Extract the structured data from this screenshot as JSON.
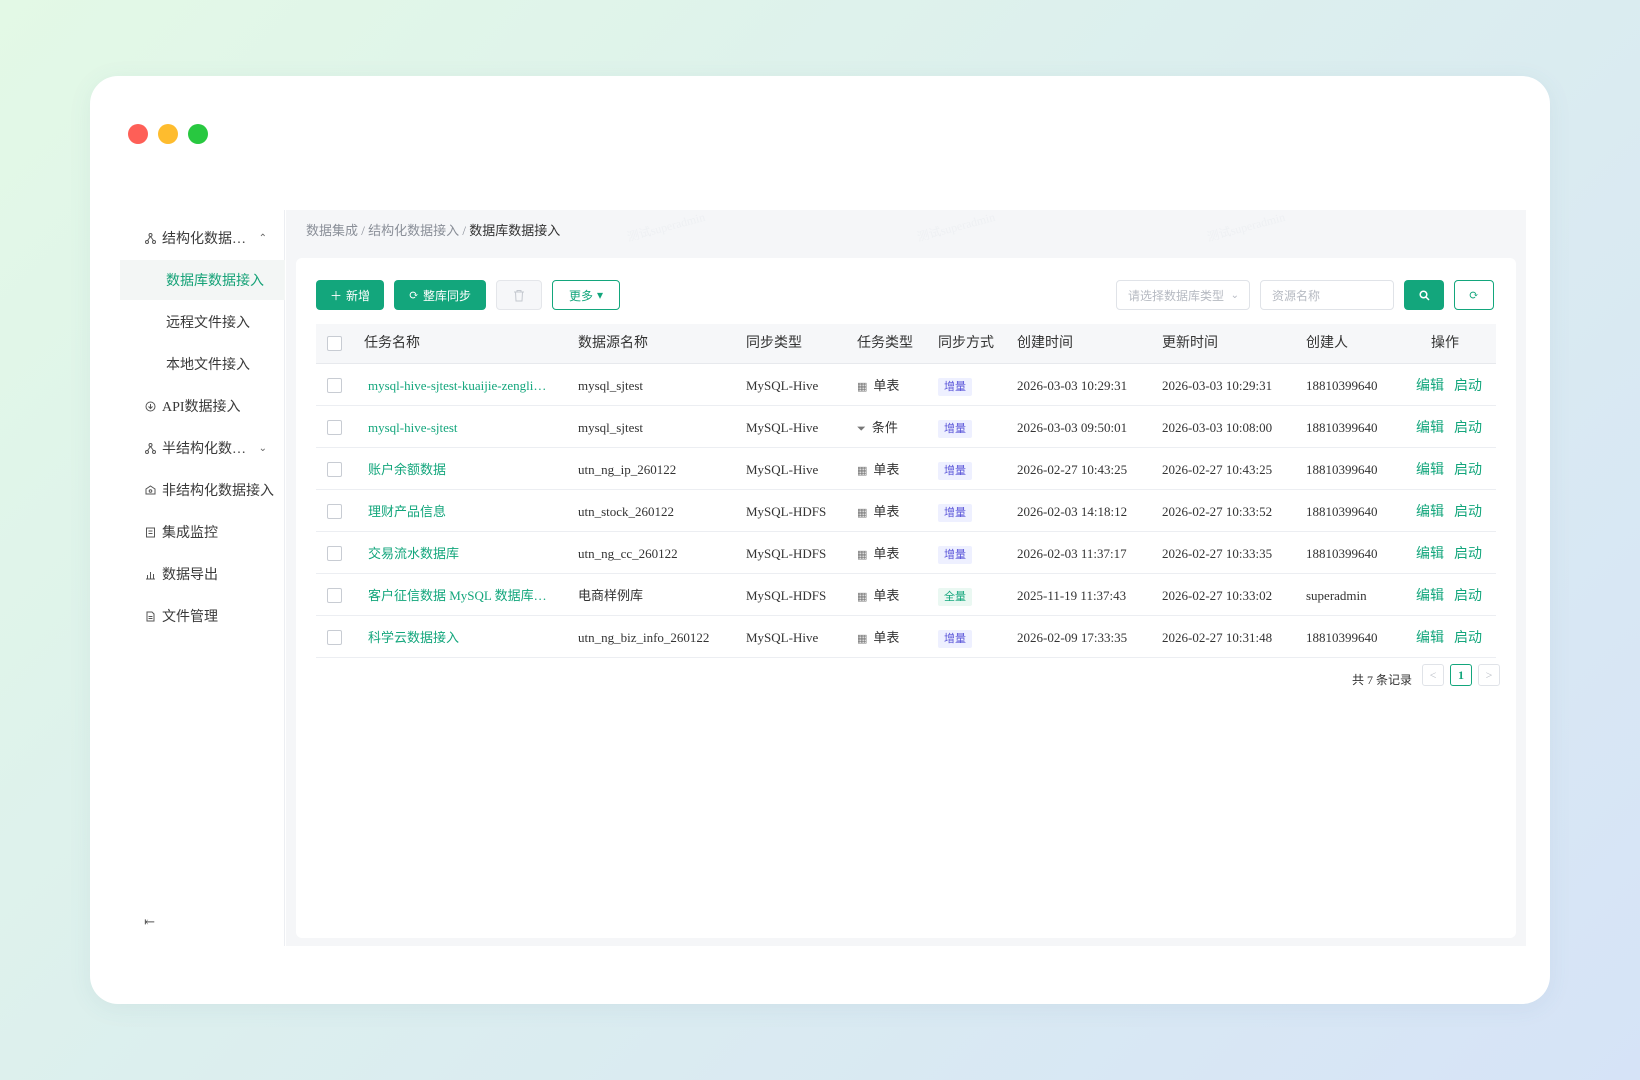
{
  "sidebar": {
    "items": [
      {
        "label": "结构化数据…",
        "icon": "structured-data-icon",
        "chevron": "⌃"
      },
      {
        "label": "数据库数据接入"
      },
      {
        "label": "远程文件接入"
      },
      {
        "label": "本地文件接入"
      },
      {
        "label": "API数据接入",
        "icon": "api-icon"
      },
      {
        "label": "半结构化数…",
        "icon": "semi-structured-icon",
        "chevron": "⌄"
      },
      {
        "label": "非结构化数据接入",
        "icon": "unstructured-icon"
      },
      {
        "label": "集成监控",
        "icon": "monitor-icon"
      },
      {
        "label": "数据导出",
        "icon": "export-icon"
      },
      {
        "label": "文件管理",
        "icon": "file-icon"
      }
    ],
    "collapse_icon": "⇤"
  },
  "breadcrumb": {
    "level1": "数据集成",
    "sep": " / ",
    "level2": "结构化数据接入",
    "current": "数据库数据接入"
  },
  "toolbar": {
    "add_label": "新增",
    "sync_label": "整库同步",
    "more_label": "更多",
    "db_type_placeholder": "请选择数据库类型",
    "resource_placeholder": "资源名称"
  },
  "table": {
    "columns": [
      "任务名称",
      "数据源名称",
      "同步类型",
      "任务类型",
      "同步方式",
      "创建时间",
      "更新时间",
      "创建人",
      "操作"
    ],
    "rows": [
      {
        "name": "mysql-hive-sjtest-kuaijie-zengli…",
        "source": "mysql_sjtest",
        "sync_type": "MySQL-Hive",
        "task_type": "单表",
        "mode": "增量",
        "created": "2026-03-03 10:29:31",
        "updated": "2026-03-03 10:29:31",
        "creator": "18810399640"
      },
      {
        "name": "mysql-hive-sjtest",
        "source": "mysql_sjtest",
        "sync_type": "MySQL-Hive",
        "task_type": "条件",
        "mode": "增量",
        "created": "2026-03-03 09:50:01",
        "updated": "2026-03-03 10:08:00",
        "creator": "18810399640"
      },
      {
        "name": "账户余额数据",
        "source": "utn_ng_ip_260122",
        "sync_type": "MySQL-Hive",
        "task_type": "单表",
        "mode": "增量",
        "created": "2026-02-27 10:43:25",
        "updated": "2026-02-27 10:43:25",
        "creator": "18810399640"
      },
      {
        "name": "理财产品信息",
        "source": "utn_stock_260122",
        "sync_type": "MySQL-HDFS",
        "task_type": "单表",
        "mode": "增量",
        "created": "2026-02-03 14:18:12",
        "updated": "2026-02-27 10:33:52",
        "creator": "18810399640"
      },
      {
        "name": "交易流水数据库",
        "source": "utn_ng_cc_260122",
        "sync_type": "MySQL-HDFS",
        "task_type": "单表",
        "mode": "增量",
        "created": "2026-02-03 11:37:17",
        "updated": "2026-02-27 10:33:35",
        "creator": "18810399640"
      },
      {
        "name": "客户征信数据 MySQL 数据库…",
        "source": "电商样例库",
        "sync_type": "MySQL-HDFS",
        "task_type": "单表",
        "mode": "全量",
        "created": "2025-11-19 11:37:43",
        "updated": "2026-02-27 10:33:02",
        "creator": "superadmin"
      },
      {
        "name": "科学云数据接入",
        "source": "utn_ng_biz_info_260122",
        "sync_type": "MySQL-Hive",
        "task_type": "单表",
        "mode": "增量",
        "created": "2026-02-09 17:33:35",
        "updated": "2026-02-27 10:31:48",
        "creator": "18810399640"
      }
    ],
    "actions": {
      "edit": "编辑",
      "start": "启动"
    }
  },
  "pagination": {
    "total_text": "共 7 条记录",
    "current_page": "1",
    "prev": "<",
    "next": ">"
  },
  "watermark": {
    "user": "测试superadmin",
    "date": "2026-03-12"
  },
  "colors": {
    "accent": "#13a67c",
    "incremental_tag": "#5a55d9",
    "full_tag": "#13a67c"
  }
}
